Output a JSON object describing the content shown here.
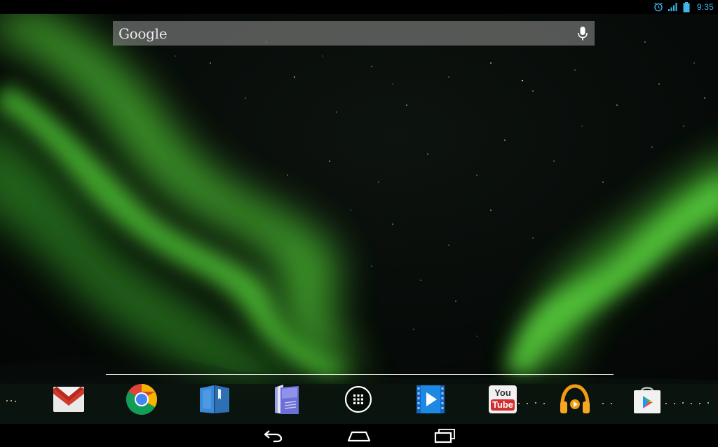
{
  "status_bar": {
    "time": "9:35",
    "icons": [
      "alarm-icon",
      "signal-icon",
      "battery-icon"
    ],
    "accent_color": "#3fb6e8"
  },
  "search": {
    "logo_text": "Google",
    "mic_icon": "mic-icon"
  },
  "wallpaper": {
    "subject": "aurora-night-sky",
    "aurora_color": "#4fbf30"
  },
  "dock": {
    "apps": [
      {
        "name": "gmail",
        "icon": "gmail-icon"
      },
      {
        "name": "chrome",
        "icon": "chrome-icon"
      },
      {
        "name": "play-books",
        "icon": "play-books-icon"
      },
      {
        "name": "play-magazines",
        "icon": "play-magazines-icon"
      },
      {
        "name": "all-apps",
        "icon": "app-drawer-icon"
      },
      {
        "name": "play-movies",
        "icon": "play-movies-icon"
      },
      {
        "name": "youtube",
        "icon": "youtube-icon",
        "label_top": "You",
        "label_bottom": "Tube"
      },
      {
        "name": "play-music",
        "icon": "headphones-icon"
      },
      {
        "name": "play-store",
        "icon": "play-store-icon"
      }
    ]
  },
  "nav_bar": {
    "buttons": [
      "back-icon",
      "home-icon",
      "recents-icon"
    ]
  }
}
